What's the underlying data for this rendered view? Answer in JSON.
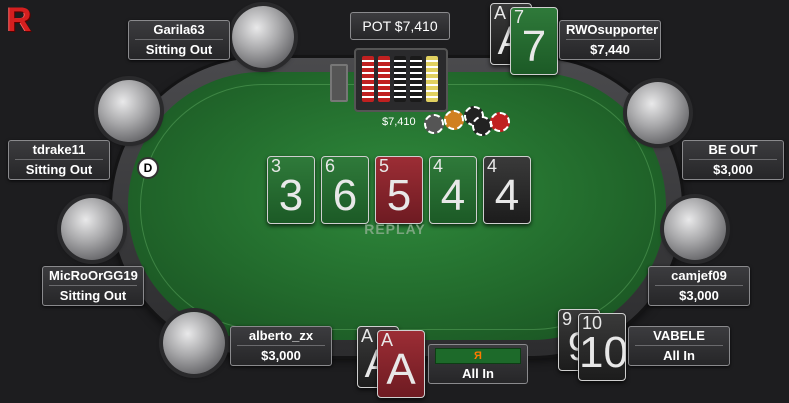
{
  "pot": {
    "label": "POT $7,410"
  },
  "pot_chips": {
    "amount": "$7,410"
  },
  "dealer_button": "D",
  "replay_label": "REPLAY",
  "board": [
    {
      "rank": "3",
      "suit": "clubs"
    },
    {
      "rank": "6",
      "suit": "clubs"
    },
    {
      "rank": "5",
      "suit": "hearts"
    },
    {
      "rank": "4",
      "suit": "clubs"
    },
    {
      "rank": "4",
      "suit": "spades"
    }
  ],
  "players": {
    "garila63": {
      "name": "Garila63",
      "status": "Sitting Out"
    },
    "rwosupporter": {
      "name": "RWOsupporter",
      "status": "$7,440",
      "cards": [
        "A",
        "7"
      ]
    },
    "tdrake11": {
      "name": "tdrake11",
      "status": "Sitting Out"
    },
    "beout": {
      "name": "BE OUT",
      "status": "$3,000"
    },
    "microorgg19": {
      "name": "MicRoOrGG19",
      "status": "Sitting Out"
    },
    "camjef09": {
      "name": "camjef09",
      "status": "$3,000"
    },
    "alberto": {
      "name": "alberto_zx",
      "status": "$3,000"
    },
    "vabele": {
      "name": "VABELE",
      "status": "All In",
      "cards": [
        "9",
        "10"
      ]
    },
    "hero": {
      "status": "All In",
      "bar_text": "Я",
      "cards": [
        "A",
        "A"
      ]
    }
  },
  "colors": {
    "felt": "#226a2c",
    "logo": "#d41f1f",
    "clubs_card": "#2f7a3a",
    "hearts_card": "#9c2d35",
    "spades_card": "#2a2a2a"
  }
}
